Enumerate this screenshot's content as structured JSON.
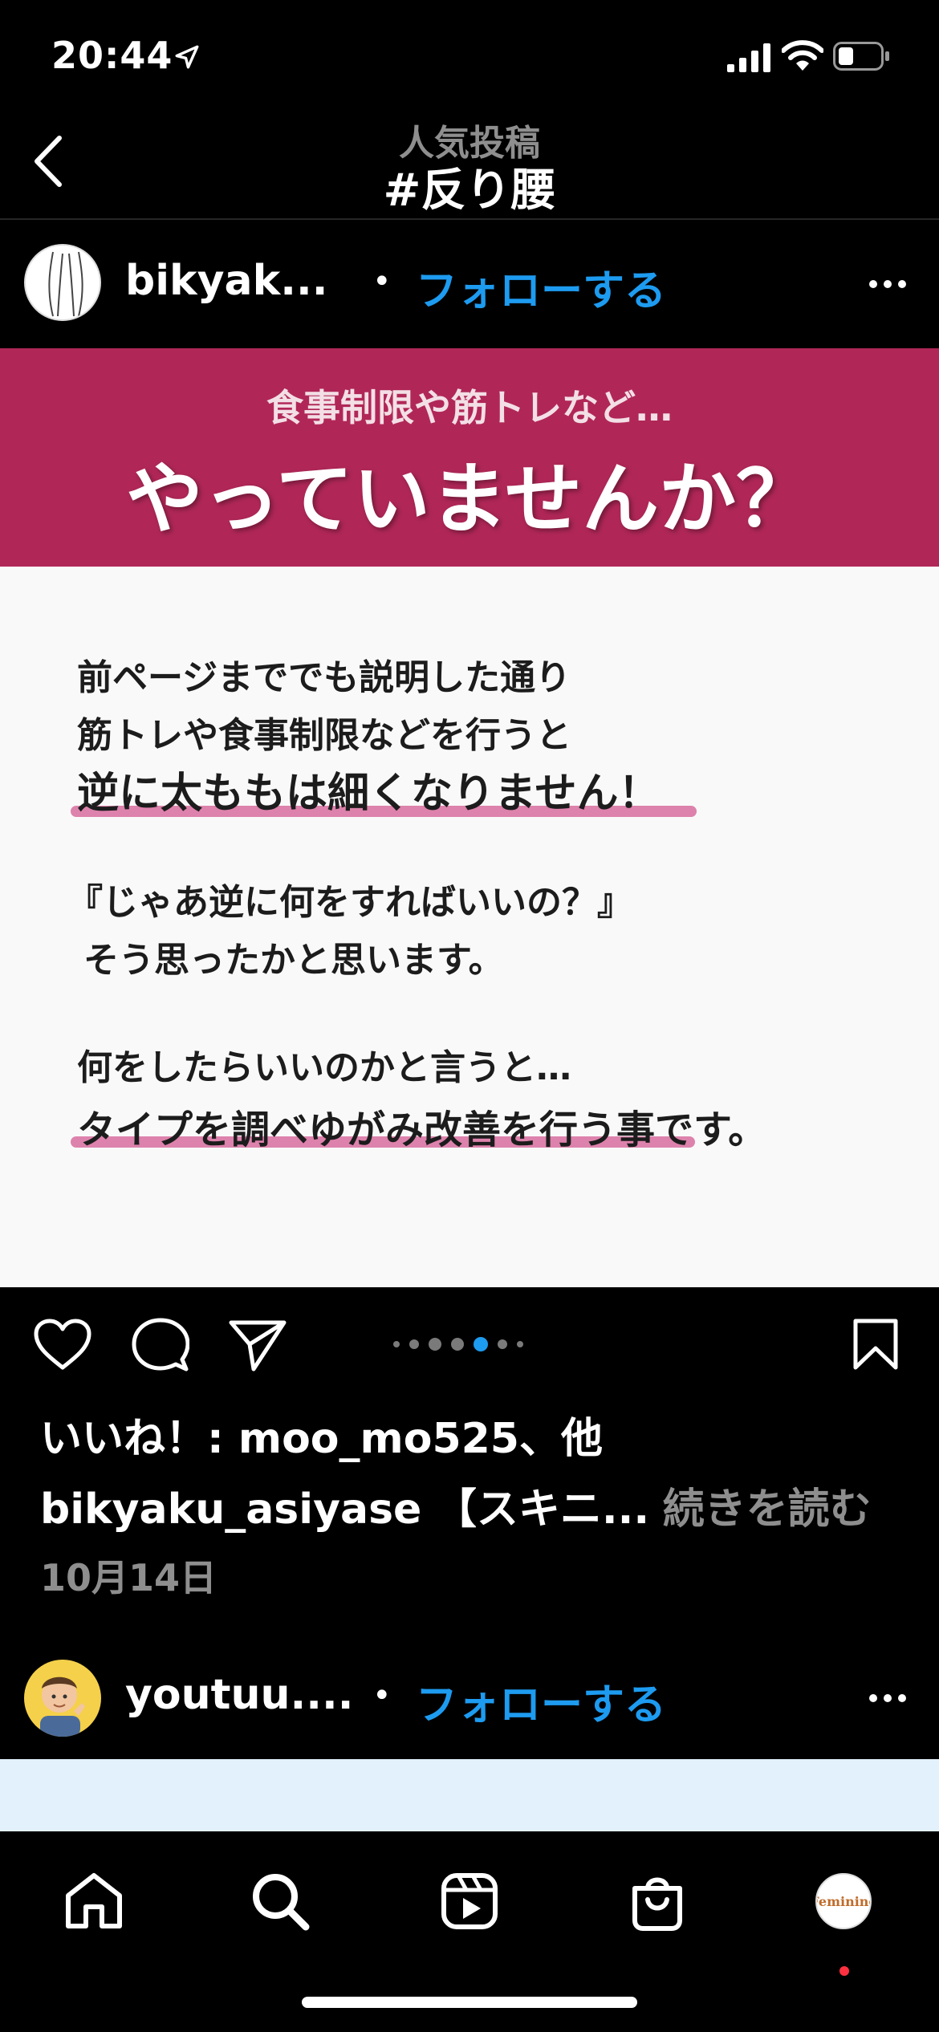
{
  "status_bar": {
    "time": "20:44"
  },
  "header": {
    "subtitle": "人気投稿",
    "title": "#反り腰"
  },
  "post": {
    "username": "bikyak...",
    "follow_label": "フォローする",
    "image": {
      "banner_sub": "食事制限や筋トレなど…",
      "banner_main": "やっていませんか？",
      "lines": [
        "前ページまででも説明した通り",
        "筋トレや食事制限などを行うと",
        "逆に太ももは細くなりません！",
        "『じゃあ逆に何をすればいいの？』",
        "そう思ったかと思います。",
        "何をしたらいいのかと言うと…",
        "タイプを調べゆがみ改善を行う事です。"
      ]
    },
    "carousel": {
      "total": 7,
      "active_index": 4
    },
    "likes": "いいね！: moo_mo525、他",
    "caption": {
      "user": "bikyaku_asiyase",
      "text": "【スキニ...",
      "more": "続きを読む"
    },
    "date": "10月14日"
  },
  "post2": {
    "username": "youtuu....",
    "follow_label": "フォローする"
  },
  "colors": {
    "accent": "#1d9bf0",
    "banner": "#b02757",
    "underline": "#d35a91",
    "notification": "#ff3040"
  },
  "tab_bar": {
    "profile_logo_text": "Feminine"
  }
}
